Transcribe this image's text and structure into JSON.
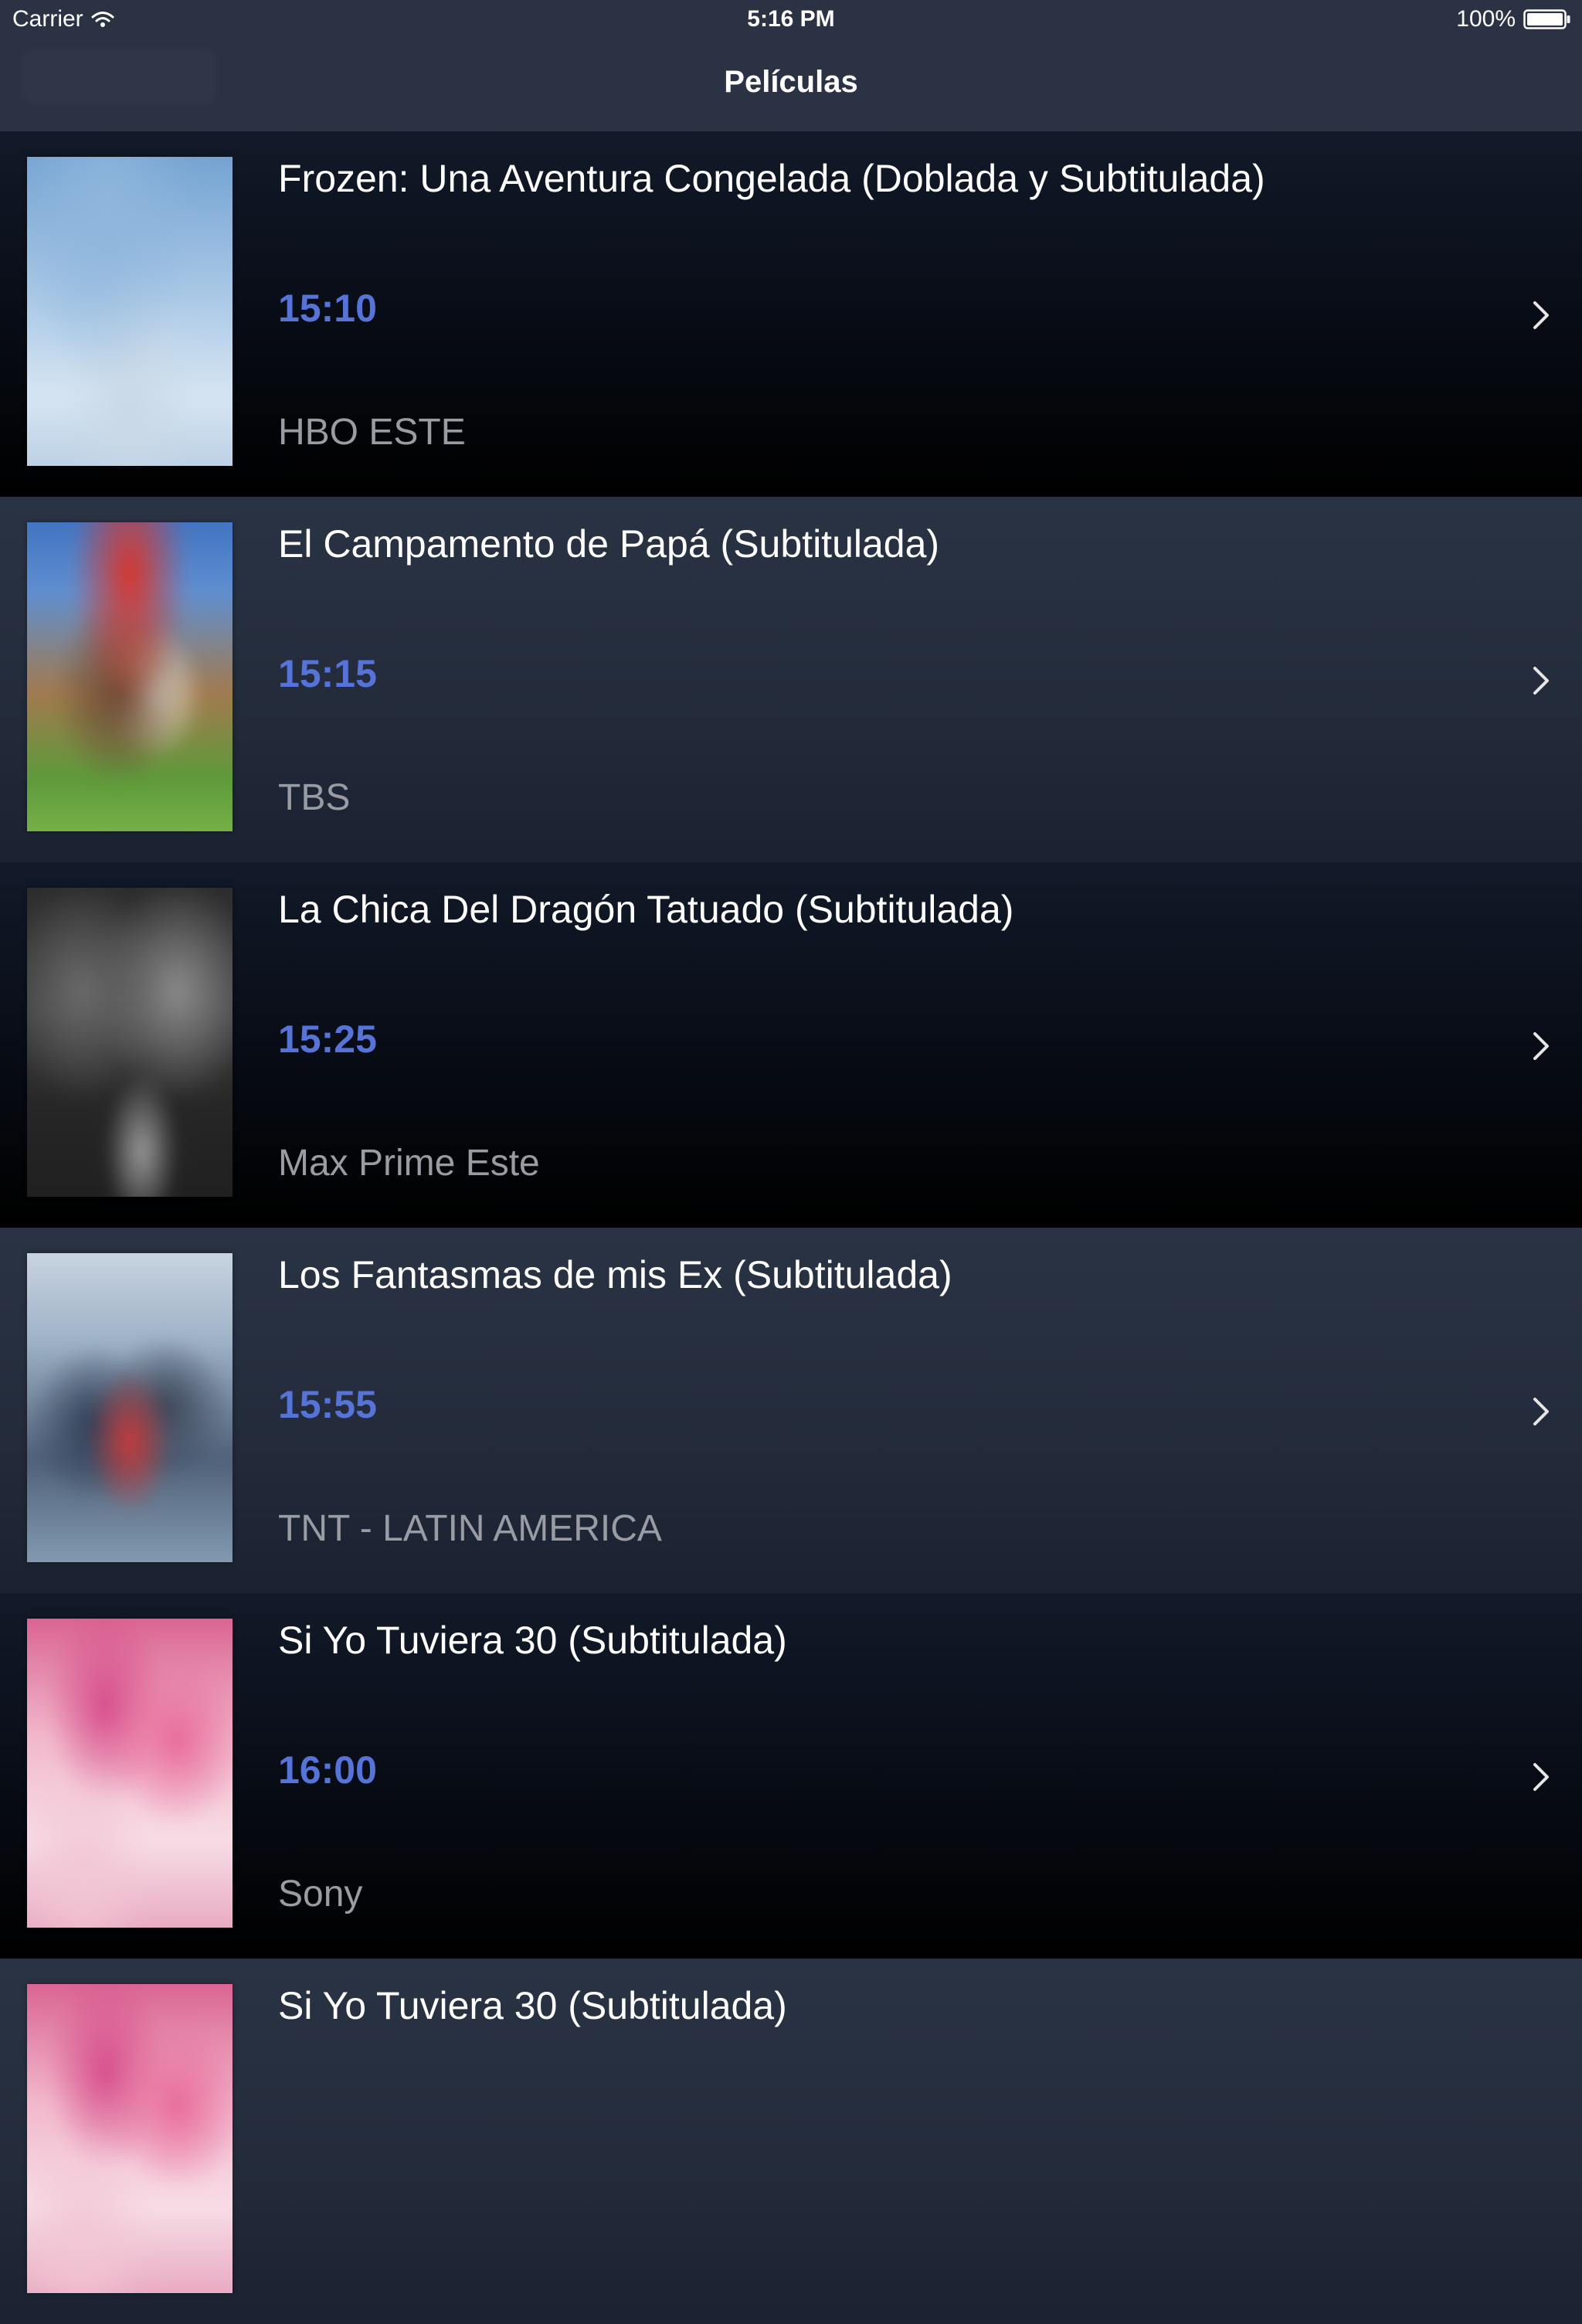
{
  "status_bar": {
    "carrier": "Carrier",
    "time": "5:16 PM",
    "battery": "100%"
  },
  "nav": {
    "title": "Películas"
  },
  "colors": {
    "time_accent": "#5673d8",
    "channel_text": "#9a9ca3",
    "nav_background": "#2a3244"
  },
  "movies": [
    {
      "title": "Frozen: Una Aventura Congelada (Doblada y Subtitulada)",
      "time": "15:10",
      "channel": "HBO ESTE",
      "poster": "poster-frozen"
    },
    {
      "title": "El Campamento de Papá (Subtitulada)",
      "time": "15:15",
      "channel": "TBS",
      "poster": "poster-campamento"
    },
    {
      "title": "La Chica Del Dragón Tatuado (Subtitulada)",
      "time": "15:25",
      "channel": "Max Prime Este",
      "poster": "poster-dragon"
    },
    {
      "title": "Los Fantasmas de mis Ex (Subtitulada)",
      "time": "15:55",
      "channel": "TNT - LATIN AMERICA",
      "poster": "poster-fantasmas"
    },
    {
      "title": "Si Yo Tuviera 30 (Subtitulada)",
      "time": "16:00",
      "channel": "Sony",
      "poster": "poster-30"
    },
    {
      "title": "Si Yo Tuviera 30 (Subtitulada)",
      "time": "",
      "channel": "",
      "poster": "poster-30"
    }
  ]
}
